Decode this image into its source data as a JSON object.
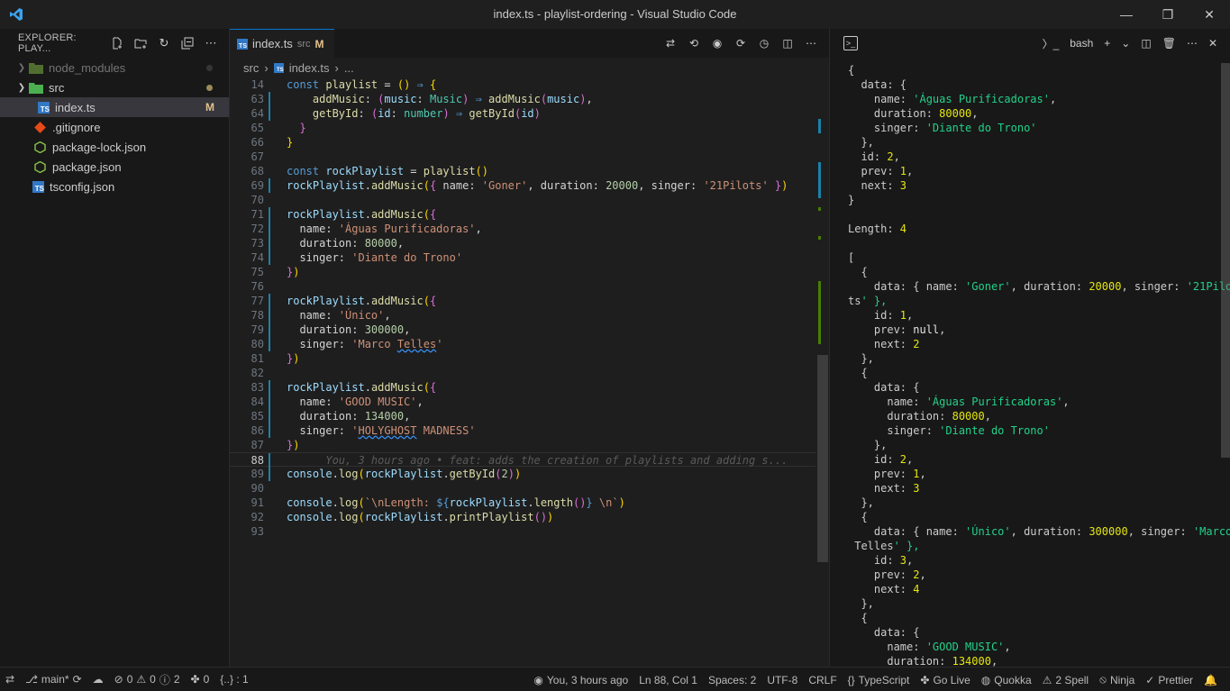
{
  "window": {
    "title": "index.ts - playlist-ordering - Visual Studio Code"
  },
  "sidebar": {
    "title": "EXPLORER: PLAY...",
    "items": [
      {
        "label": "node_modules",
        "type": "folder",
        "expanded": false,
        "dim": true,
        "status": "dot-gray"
      },
      {
        "label": "src",
        "type": "folder",
        "expanded": true,
        "status": "dot-yellow"
      },
      {
        "label": "index.ts",
        "type": "ts",
        "status": "M",
        "active": true
      },
      {
        "label": ".gitignore",
        "type": "git"
      },
      {
        "label": "package-lock.json",
        "type": "npm"
      },
      {
        "label": "package.json",
        "type": "npm"
      },
      {
        "label": "tsconfig.json",
        "type": "tsconfig"
      }
    ]
  },
  "tab": {
    "label": "index.ts",
    "dir": "src",
    "status": "M"
  },
  "breadcrumb": {
    "part1": "src",
    "sep": "›",
    "part2": "index.ts",
    "part3": "..."
  },
  "code": {
    "line_numbers": [
      "14",
      "63",
      "64",
      "65",
      "66",
      "67",
      "68",
      "69",
      "70",
      "71",
      "72",
      "73",
      "74",
      "75",
      "76",
      "77",
      "78",
      "79",
      "80",
      "81",
      "82",
      "83",
      "84",
      "85",
      "86",
      "87",
      "88",
      "89",
      "90",
      "91",
      "92",
      "93"
    ],
    "blame": "You, 3 hours ago • feat: adds the creation of playlists and adding s..."
  },
  "terminal": {
    "shell": "bash",
    "lines": [
      "{",
      "  data: {",
      "    name: 'Águas Purificadoras',",
      "    duration: 80000,",
      "    singer: 'Diante do Trono'",
      "  },",
      "  id: 2,",
      "  prev: 1,",
      "  next: 3",
      "}",
      "",
      "Length: 4",
      "",
      "[",
      "  {",
      "    data: { name: 'Goner', duration: 20000, singer: '21Pilo",
      "ts' },",
      "    id: 1,",
      "    prev: null,",
      "    next: 2",
      "  },",
      "  {",
      "    data: {",
      "      name: 'Águas Purificadoras',",
      "      duration: 80000,",
      "      singer: 'Diante do Trono'",
      "    },",
      "    id: 2,",
      "    prev: 1,",
      "    next: 3",
      "  },",
      "  {",
      "    data: { name: 'Único', duration: 300000, singer: 'Marco",
      " Telles' },",
      "    id: 3,",
      "    prev: 2,",
      "    next: 4",
      "  },",
      "  {",
      "    data: {",
      "      name: 'GOOD MUSIC',",
      "      duration: 134000,"
    ]
  },
  "status": {
    "branch": "main*",
    "errors": "0",
    "warnings": "0",
    "info": "2",
    "ports": "0",
    "braces": "{..} : 1",
    "blame": "You, 3 hours ago",
    "position": "Ln 88, Col 1",
    "spaces": "Spaces: 2",
    "encoding": "UTF-8",
    "eol": "CRLF",
    "language": "TypeScript",
    "golive": "Go Live",
    "quokka": "Quokka",
    "spell": "2 Spell",
    "ninja": "Ninja",
    "prettier": "Prettier"
  },
  "colors": {
    "accent": "#0078d4",
    "ts": "#3178c6",
    "modified": "#e2c08d"
  }
}
